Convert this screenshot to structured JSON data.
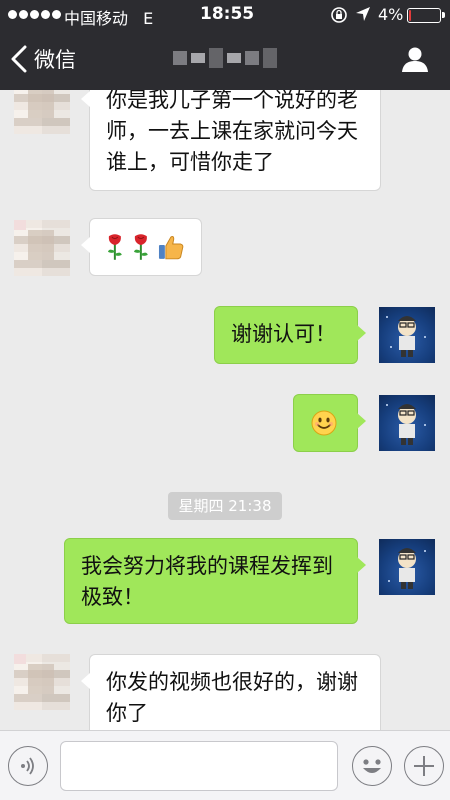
{
  "status_bar": {
    "carrier": "中国移动",
    "network": "E",
    "time": "18:55",
    "battery": "4%",
    "battery_level": 0.04,
    "battery_color": "#e23b3b"
  },
  "nav": {
    "back_label": "微信"
  },
  "messages": [
    {
      "from": "them",
      "text": "你是我儿子第一个说好的老师，一去上课在家就问今天谁上，可惜你走了"
    },
    {
      "from": "them",
      "icons": [
        "rose-icon",
        "rose-icon",
        "thumbs-up-icon"
      ]
    },
    {
      "from": "me",
      "text": "谢谢认可！"
    },
    {
      "from": "me",
      "icons": [
        "smile-icon"
      ]
    },
    {
      "from": "me",
      "text": "我会努力将我的课程发挥到极致！"
    },
    {
      "from": "them",
      "text": "你发的视频也很好的，谢谢你了"
    }
  ],
  "timestamp": "星期四 21:38",
  "colors": {
    "nav_bg": "#2c2c30",
    "chat_bg": "#ebebeb",
    "my_bubble": "#a0e75a",
    "their_bubble": "#ffffff"
  }
}
